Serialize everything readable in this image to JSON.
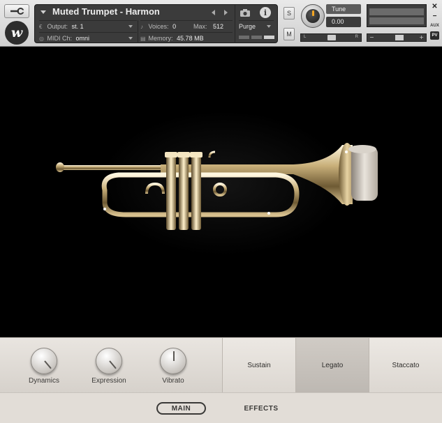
{
  "header": {
    "instrument_name": "Muted Trumpet - Harmon",
    "output_label": "Output:",
    "output_value": "st. 1",
    "midi_label": "MIDI Ch:",
    "midi_value": "omni",
    "voices_label": "Voices:",
    "voices_value": "0",
    "max_label": "Max:",
    "max_value": "512",
    "memory_label": "Memory:",
    "memory_value": "45.78 MB",
    "purge_label": "Purge",
    "solo_label": "S",
    "mute_label": "M",
    "tune_label": "Tune",
    "tune_value": "0.00",
    "pan_left": "L",
    "pan_right": "R",
    "logo_letter": "w",
    "aux_label": "AUX",
    "pv_label": "PV"
  },
  "controls": {
    "knobs": [
      {
        "label": "Dynamics"
      },
      {
        "label": "Expression"
      },
      {
        "label": "Vibrato"
      }
    ],
    "articulations": [
      {
        "label": "Sustain",
        "active": false
      },
      {
        "label": "Legato",
        "active": true
      },
      {
        "label": "Staccato",
        "active": false
      }
    ]
  },
  "tabs": {
    "main": "MAIN",
    "effects": "EFFECTS",
    "active": "MAIN"
  }
}
